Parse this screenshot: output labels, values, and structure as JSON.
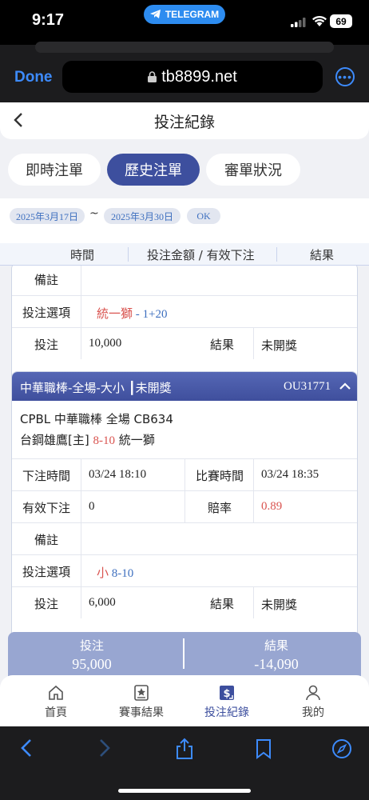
{
  "status": {
    "time": "9:17",
    "app_pill": "TELEGRAM",
    "battery": "69"
  },
  "browser": {
    "done": "Done",
    "url": "tb8899.net"
  },
  "page": {
    "title": "投注紀錄"
  },
  "tabs": [
    {
      "label": "即時注單",
      "active": false
    },
    {
      "label": "歷史注單",
      "active": true
    },
    {
      "label": "審單狀況",
      "active": false
    }
  ],
  "dates": {
    "from": "2025年3月17日",
    "tilde": "~",
    "to": "2025年3月30日",
    "ok": "OK"
  },
  "columns": [
    "時間",
    "投注金額 / 有效下注",
    "結果"
  ],
  "card1": {
    "remark_label": "備註",
    "remark_value": "",
    "option_label": "投注選項",
    "option_team": "統一獅",
    "option_line": " - 1+20",
    "stake_label": "投注",
    "stake_value": "10,000",
    "result_label": "結果",
    "result_value": "未開獎"
  },
  "card2": {
    "title": "中華職棒-全場-大小 ┃未開獎",
    "code": "OU31771",
    "league_line": "CPBL 中華職棒 全場 CB634",
    "home_team": "台鋼雄鷹[主]",
    "score": "8-10",
    "away_team": "統一獅",
    "placed_label": "下注時間",
    "placed_value": "03/24 18:10",
    "match_label": "比賽時間",
    "match_value": "03/24 18:35",
    "valid_label": "有效下注",
    "valid_value": "0",
    "odds_label": "賠率",
    "odds_value": "0.89",
    "remark_label": "備註",
    "remark_value": "",
    "option_label": "投注選項",
    "option_pick": "小",
    "option_line": " 8-10",
    "stake_label": "投注",
    "stake_value": "6,000",
    "result_label": "結果",
    "result_value": "未開獎"
  },
  "summary": {
    "bet_label": "投注",
    "bet_value": "95,000",
    "result_label": "結果",
    "result_value": "-14,090"
  },
  "nav": [
    {
      "label": "首頁",
      "icon": "home-icon",
      "active": false
    },
    {
      "label": "賽事結果",
      "icon": "star-card-icon",
      "active": false
    },
    {
      "label": "投注紀錄",
      "icon": "dollar-record-icon",
      "active": true
    },
    {
      "label": "我的",
      "icon": "user-icon",
      "active": false
    }
  ],
  "colors": {
    "accent": "#3d4f9e",
    "link": "#3d8bfd",
    "red": "#d9534f",
    "blue": "#3d6fbf"
  }
}
